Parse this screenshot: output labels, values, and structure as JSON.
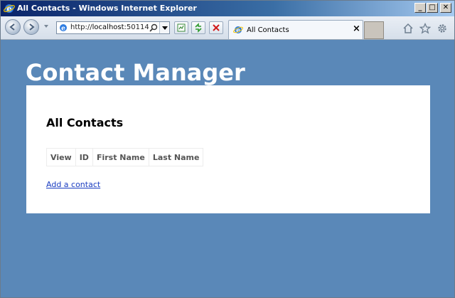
{
  "window": {
    "title": "All Contacts - Windows Internet Explorer",
    "minimize_glyph": "_",
    "maximize_glyph": "□",
    "close_glyph": "✕"
  },
  "browser": {
    "address_prefix": "http://",
    "address_host": "localhost",
    "address_rest": ":50114",
    "tab_title": "All Contacts",
    "tab_close_glyph": "×",
    "icons": [
      "ie-logo-icon",
      "back-icon",
      "forward-icon",
      "search-icon",
      "compatibility-icon",
      "refresh-icon",
      "stop-icon",
      "home-icon",
      "favorites-star-icon",
      "tools-gear-icon"
    ]
  },
  "page": {
    "site_title": "Contact Manager",
    "heading": "All Contacts",
    "table_headers": [
      "View",
      "ID",
      "First Name",
      "Last Name"
    ],
    "add_link": "Add a contact"
  },
  "colors": {
    "page_background": "#5a88b8",
    "panel_background": "#ffffff",
    "link": "#1a3dc1",
    "titlebar_start": "#0a246a"
  }
}
